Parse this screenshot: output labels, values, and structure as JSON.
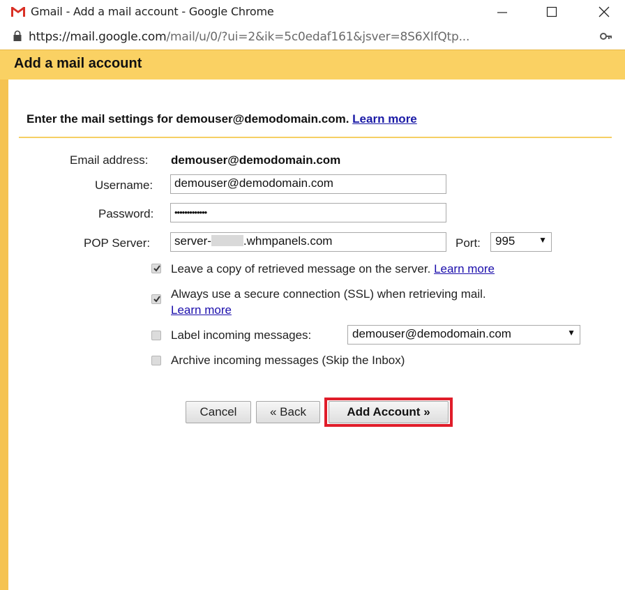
{
  "window": {
    "title": "Gmail - Add a mail account - Google Chrome",
    "url_host": "https://mail.google.com",
    "url_path": "/mail/u/0/?ui=2&ik=5c0edaf161&jsver=8S6XIfQtp..."
  },
  "dialog": {
    "title": "Add a mail account",
    "intro": "Enter the mail settings for demouser@demodomain.com.",
    "intro_link": "Learn more"
  },
  "form": {
    "email_label": "Email address:",
    "email_value": "demouser@demodomain.com",
    "username_label": "Username:",
    "username_value": "demouser@demodomain.com",
    "password_label": "Password:",
    "password_value": "•••••••••••••",
    "pop_label": "POP Server:",
    "pop_value_prefix": "server-",
    "pop_value_suffix": ".whmpanels.com",
    "port_label": "Port:",
    "port_value": "995"
  },
  "options": {
    "leave_copy": {
      "label": "Leave a copy of retrieved message on the server.",
      "link": "Learn more",
      "checked": true
    },
    "ssl": {
      "label": "Always use a secure connection (SSL) when retrieving mail.",
      "link": "Learn more",
      "checked": true
    },
    "label_incoming": {
      "label": "Label incoming messages:",
      "select_value": "demouser@demodomain.com",
      "checked": false
    },
    "archive": {
      "label": "Archive incoming messages (Skip the Inbox)",
      "checked": false
    }
  },
  "buttons": {
    "cancel": "Cancel",
    "back": "« Back",
    "add": "Add Account »"
  },
  "colors": {
    "header_bg": "#fad163",
    "highlight": "#e01d2a",
    "link": "#1a0dab"
  }
}
